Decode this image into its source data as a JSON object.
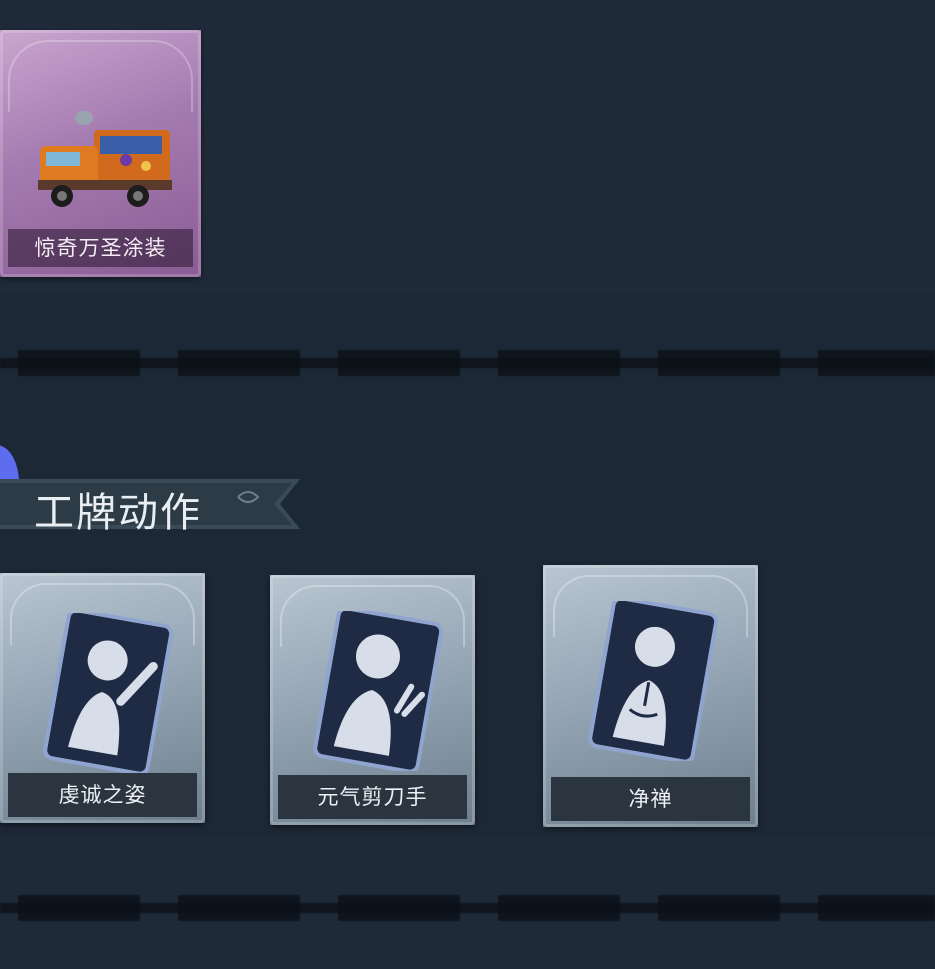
{
  "top_section": {
    "skin_item": {
      "label": "惊奇万圣涂装",
      "icon": "halloween-truck-skin"
    }
  },
  "badge_section": {
    "title": "工牌动作",
    "items": [
      {
        "label": "虔诚之姿",
        "icon": "pose-raised-arm-silhouette"
      },
      {
        "label": "元气剪刀手",
        "icon": "pose-peace-sign-silhouette"
      },
      {
        "label": "净禅",
        "icon": "pose-meditation-silhouette"
      }
    ]
  },
  "colors": {
    "background": "#1f2a38",
    "skin_card": "#a47bb0",
    "action_card": "#8e9fae",
    "emote_card": "#1f2a44",
    "accent_dot": "#5e6cf0"
  }
}
